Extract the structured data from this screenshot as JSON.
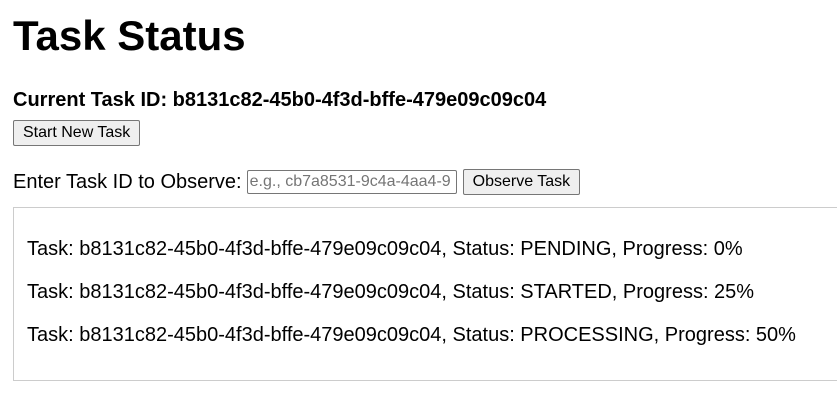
{
  "page": {
    "title": "Task Status"
  },
  "current_task": {
    "label": "Current Task ID: b8131c82-45b0-4f3d-bffe-479e09c09c04"
  },
  "actions": {
    "start_new_task_label": "Start New Task",
    "observe_label": "Enter Task ID to Observe:",
    "observe_placeholder": "e.g., cb7a8531-9c4a-4aa4-9",
    "observe_input_value": "",
    "observe_button_label": "Observe Task"
  },
  "log": {
    "entries": [
      "Task: b8131c82-45b0-4f3d-bffe-479e09c09c04, Status: PENDING, Progress: 0%",
      "Task: b8131c82-45b0-4f3d-bffe-479e09c09c04, Status: STARTED, Progress: 25%",
      "Task: b8131c82-45b0-4f3d-bffe-479e09c09c04, Status: PROCESSING, Progress: 50%"
    ]
  }
}
